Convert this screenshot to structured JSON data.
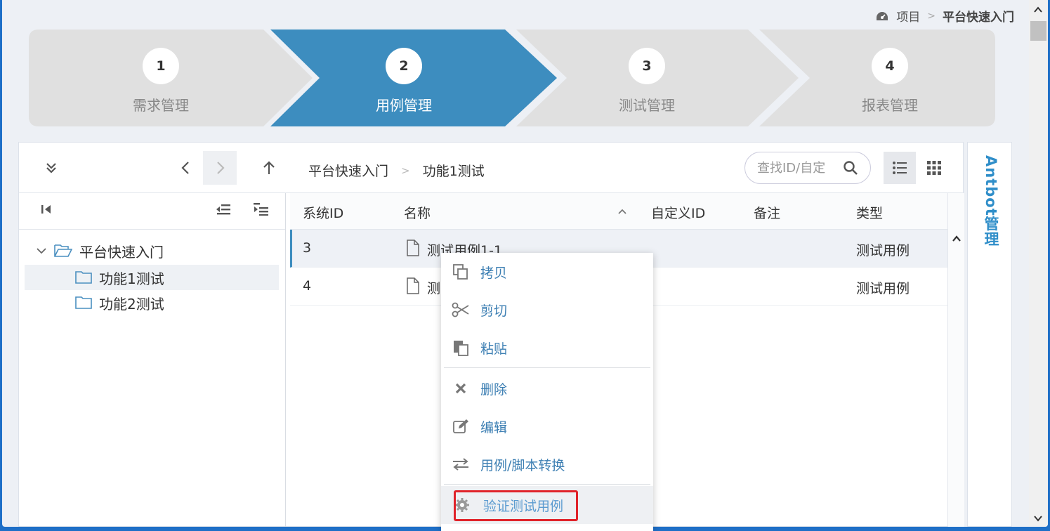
{
  "breadcrumb": {
    "root": "项目",
    "sep": ">",
    "current": "平台快速入门"
  },
  "steps": [
    {
      "num": "1",
      "label": "需求管理"
    },
    {
      "num": "2",
      "label": "用例管理"
    },
    {
      "num": "3",
      "label": "测试管理"
    },
    {
      "num": "4",
      "label": "报表管理"
    }
  ],
  "colors": {
    "active_step": "#3d8dbf",
    "inactive_step": "#e0e0e0",
    "link_text": "#3d7fb3",
    "highlight_border": "#e0232a"
  },
  "toolbar": {
    "path": [
      "平台快速入门",
      "功能1测试"
    ],
    "path_sep": ">",
    "search_placeholder": "查找ID/自定"
  },
  "tree": [
    {
      "label": "平台快速入门",
      "icon": "folder-open-icon"
    },
    {
      "label": "功能1测试",
      "icon": "folder-icon"
    },
    {
      "label": "功能2测试",
      "icon": "folder-icon"
    }
  ],
  "table": {
    "columns": [
      "系统ID",
      "名称",
      "自定义ID",
      "备注",
      "类型"
    ],
    "rows": [
      {
        "id": "3",
        "name": "测试用例1-1",
        "custom": "",
        "note": "",
        "type": "测试用例"
      },
      {
        "id": "4",
        "name": "测i",
        "custom": "",
        "note": "",
        "type": "测试用例"
      }
    ]
  },
  "side_tab": "Antbot管理",
  "context_menu": [
    {
      "label": "拷贝",
      "icon": "copy-icon"
    },
    {
      "label": "剪切",
      "icon": "scissors-icon"
    },
    {
      "label": "粘贴",
      "icon": "paste-icon"
    },
    {
      "label": "删除",
      "icon": "close-icon"
    },
    {
      "label": "编辑",
      "icon": "edit-icon"
    },
    {
      "label": "用例/脚本转换",
      "icon": "exchange-icon"
    },
    {
      "label": "验证测试用例",
      "icon": "gear-icon"
    }
  ]
}
